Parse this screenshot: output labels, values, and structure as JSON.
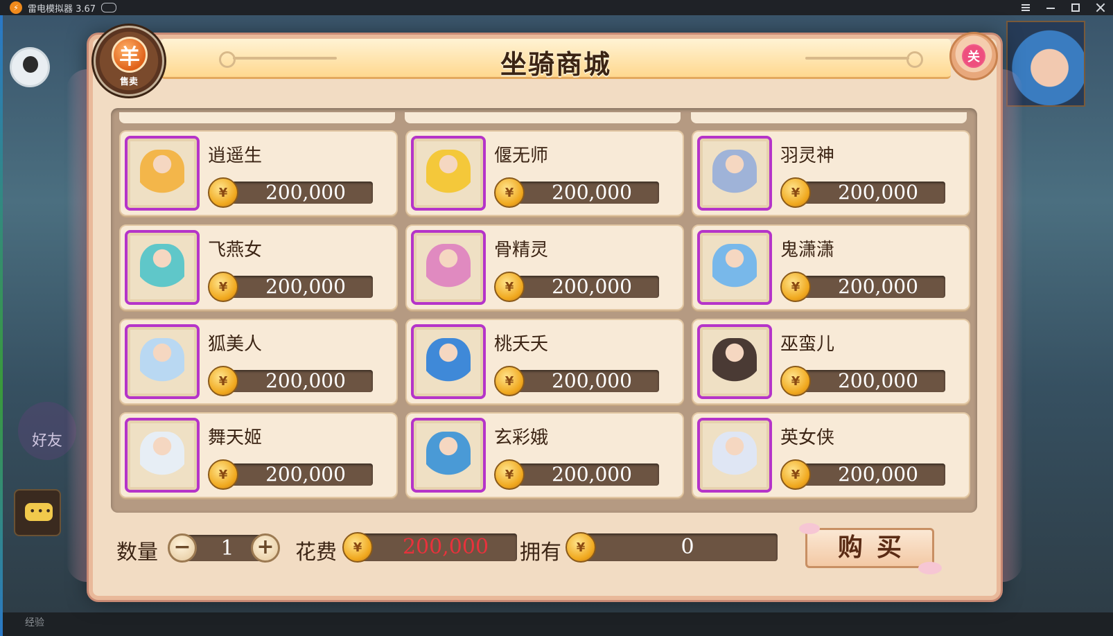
{
  "emulator": {
    "title": "雷电模拟器 3.67"
  },
  "background": {
    "friend_label": "好友",
    "bottom_text": "经验"
  },
  "shop": {
    "title": "坐骑商城",
    "sell_label": "售卖",
    "sell_glyph": "羊",
    "close_glyph": "关",
    "items": [
      {
        "name": "逍遥生",
        "price": "200,000",
        "color": "#f3b64a"
      },
      {
        "name": "偃无师",
        "price": "200,000",
        "color": "#f4c83a"
      },
      {
        "name": "羽灵神",
        "price": "200,000",
        "color": "#9fb3d8"
      },
      {
        "name": "飞燕女",
        "price": "200,000",
        "color": "#5fc7c9"
      },
      {
        "name": "骨精灵",
        "price": "200,000",
        "color": "#e08ac0"
      },
      {
        "name": "鬼潇潇",
        "price": "200,000",
        "color": "#78b8ea"
      },
      {
        "name": "狐美人",
        "price": "200,000",
        "color": "#b9d8f2"
      },
      {
        "name": "桃夭夭",
        "price": "200,000",
        "color": "#3f89d8"
      },
      {
        "name": "巫蛮儿",
        "price": "200,000",
        "color": "#4a3a34"
      },
      {
        "name": "舞天姬",
        "price": "200,000",
        "color": "#e7eef5"
      },
      {
        "name": "玄彩娥",
        "price": "200,000",
        "color": "#4a9ad6"
      },
      {
        "name": "英女侠",
        "price": "200,000",
        "color": "#dfe6f4"
      }
    ],
    "footer": {
      "quantity_label": "数量",
      "quantity_value": "1",
      "minus_glyph": "−",
      "plus_glyph": "+",
      "cost_label": "花费",
      "cost_value": "200,000",
      "owned_label": "拥有",
      "owned_value": "0",
      "buy_label": "购买"
    },
    "coin_glyph": "¥",
    "colors": {
      "rarity_frame": "#b534c9",
      "cost_text": "#e8323c",
      "price_text": "#ffffff"
    }
  }
}
